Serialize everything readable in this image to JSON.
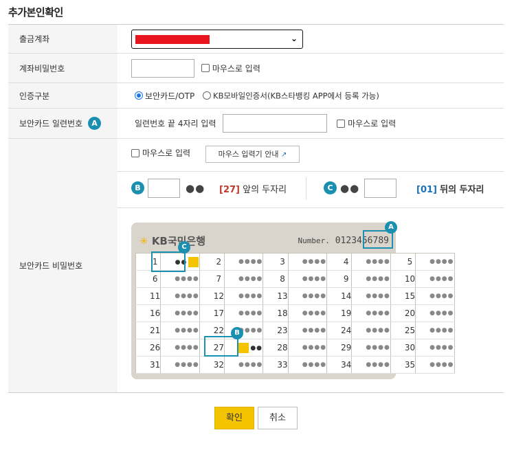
{
  "page_title": "추가본인확인",
  "account": {
    "label": "출금계좌",
    "redaction_color": "#e8141e"
  },
  "account_password": {
    "label": "계좌비밀번호",
    "mouse_input_label": "마우스로 입력"
  },
  "auth_type": {
    "label": "인증구분",
    "options": [
      {
        "label": "보안카드/OTP",
        "selected": true
      },
      {
        "label": "KB모바일인증서(KB스타뱅킹 APP에서 등록 가능)",
        "selected": false
      }
    ]
  },
  "serial": {
    "label": "보안카드 일련번호",
    "badge": "A",
    "hint": "일련번호 끝 4자리 입력",
    "mouse_input_label": "마우스로 입력"
  },
  "card_password": {
    "label": "보안카드 비밀번호",
    "mouse_input_label": "마우스로 입력",
    "guide_button": "마우스 입력기 안내",
    "front": {
      "badge": "B",
      "dots": "●●",
      "index": "[27]",
      "text": "앞의 두자리"
    },
    "back": {
      "badge": "C",
      "dots": "●●",
      "index": "[01]",
      "text": "뒤의 두자리"
    }
  },
  "security_card": {
    "bank_name": "KB국민은행",
    "number_label": "Number.",
    "number": "0123456789",
    "cell_dots": "●●●●",
    "highlight_color": "#1a8fb0",
    "badges": [
      "A",
      "B",
      "C"
    ],
    "partial_dots": "●●",
    "rows": [
      [
        1,
        2,
        3,
        4,
        5
      ],
      [
        6,
        7,
        8,
        9,
        10
      ],
      [
        11,
        12,
        13,
        14,
        15
      ],
      [
        16,
        17,
        18,
        19,
        20
      ],
      [
        21,
        22,
        23,
        24,
        25
      ],
      [
        26,
        27,
        28,
        29,
        30
      ],
      [
        31,
        32,
        33,
        34,
        35
      ]
    ]
  },
  "buttons": {
    "confirm": "확인",
    "cancel": "취소"
  }
}
